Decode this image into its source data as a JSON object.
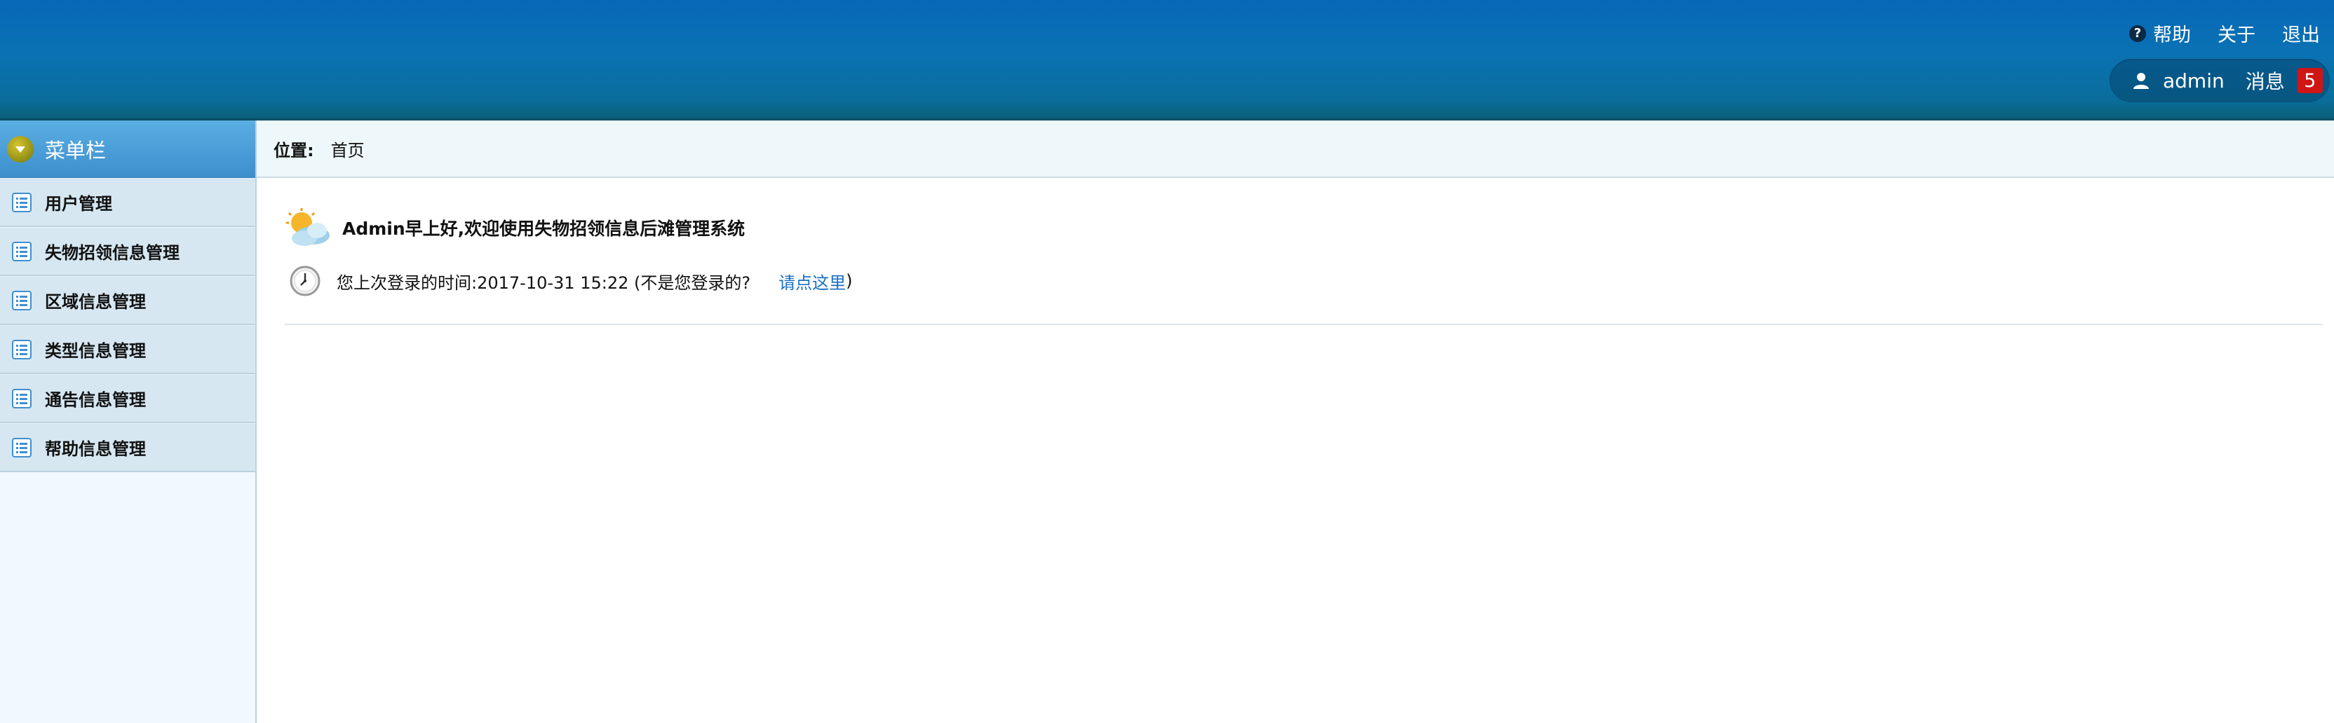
{
  "header": {
    "links": [
      {
        "label": "帮助",
        "icon": "help-icon"
      },
      {
        "label": "关于"
      },
      {
        "label": "退出"
      }
    ],
    "user": {
      "name": "admin",
      "messages_label": "消息",
      "messages_count": "5"
    }
  },
  "sidebar": {
    "title": "菜单栏",
    "items": [
      {
        "label": "用户管理"
      },
      {
        "label": "失物招领信息管理"
      },
      {
        "label": "区域信息管理"
      },
      {
        "label": "类型信息管理"
      },
      {
        "label": "通告信息管理"
      },
      {
        "label": "帮助信息管理"
      }
    ]
  },
  "breadcrumb": {
    "label": "位置:",
    "current": "首页"
  },
  "welcome": {
    "greeting": "Admin早上好,欢迎使用失物招领信息后滩管理系统",
    "last_login_text": "您上次登录的时间:2017-10-31 15:22 (不是您登录的?",
    "link_text": "请点这里",
    "close_paren": ")"
  },
  "colors": {
    "header_top": "#0768b7",
    "header_bottom": "#0b5f78",
    "sidebar_bg": "#f0f9fd",
    "menu_item_bg": "#d6e7f2",
    "badge": "#d01515",
    "link": "#1a6fc2"
  }
}
